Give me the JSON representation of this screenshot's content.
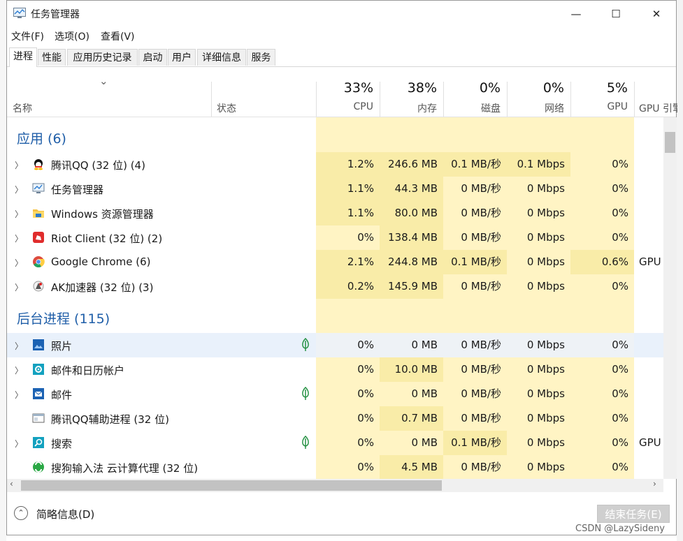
{
  "window": {
    "title": "任务管理器",
    "minimize": "—",
    "maximize": "☐",
    "close": "✕"
  },
  "menu": [
    "文件(F)",
    "选项(O)",
    "查看(V)"
  ],
  "tabs": [
    "进程",
    "性能",
    "应用历史记录",
    "启动",
    "用户",
    "详细信息",
    "服务"
  ],
  "header": {
    "sort_arrow": "⌄",
    "name": "名称",
    "status": "状态",
    "cpu": {
      "pct": "33%",
      "label": "CPU"
    },
    "mem": {
      "pct": "38%",
      "label": "内存"
    },
    "disk": {
      "pct": "0%",
      "label": "磁盘"
    },
    "net": {
      "pct": "0%",
      "label": "网络"
    },
    "gpu": {
      "pct": "5%",
      "label": "GPU"
    },
    "gpu_engine": "GPU 引擎"
  },
  "groups": {
    "apps": "应用 (6)",
    "background": "后台进程 (115)"
  },
  "apps": [
    {
      "name": "腾讯QQ (32 位) (4)",
      "icon": "qq-icon",
      "cpu": "1.2%",
      "mem": "246.6 MB",
      "disk": "0.1 MB/秒",
      "net": "0.1 Mbps",
      "gpu": "0%",
      "engine": ""
    },
    {
      "name": "任务管理器",
      "icon": "task-manager-icon",
      "cpu": "1.1%",
      "mem": "44.3 MB",
      "disk": "0 MB/秒",
      "net": "0 Mbps",
      "gpu": "0%",
      "engine": ""
    },
    {
      "name": "Windows 资源管理器",
      "icon": "folder-icon",
      "cpu": "1.1%",
      "mem": "80.0 MB",
      "disk": "0 MB/秒",
      "net": "0 Mbps",
      "gpu": "0%",
      "engine": ""
    },
    {
      "name": "Riot Client (32 位) (2)",
      "icon": "riot-icon",
      "cpu": "0%",
      "mem": "138.4 MB",
      "disk": "0 MB/秒",
      "net": "0 Mbps",
      "gpu": "0%",
      "engine": ""
    },
    {
      "name": "Google Chrome (6)",
      "icon": "chrome-icon",
      "cpu": "2.1%",
      "mem": "244.8 MB",
      "disk": "0.1 MB/秒",
      "net": "0 Mbps",
      "gpu": "0.6%",
      "engine": "GPU"
    },
    {
      "name": "AK加速器 (32 位) (3)",
      "icon": "ak-accelerator-icon",
      "cpu": "0.2%",
      "mem": "145.9 MB",
      "disk": "0 MB/秒",
      "net": "0 Mbps",
      "gpu": "0%",
      "engine": ""
    }
  ],
  "background": [
    {
      "name": "照片",
      "icon": "photos-icon",
      "cpu": "0%",
      "mem": "0 MB",
      "disk": "0 MB/秒",
      "net": "0 Mbps",
      "gpu": "0%",
      "engine": ""
    },
    {
      "name": "邮件和日历帐户",
      "icon": "gear-icon",
      "cpu": "0%",
      "mem": "10.0 MB",
      "disk": "0 MB/秒",
      "net": "0 Mbps",
      "gpu": "0%",
      "engine": ""
    },
    {
      "name": "邮件",
      "icon": "mail-icon",
      "cpu": "0%",
      "mem": "0 MB",
      "disk": "0 MB/秒",
      "net": "0 Mbps",
      "gpu": "0%",
      "engine": ""
    },
    {
      "name": "腾讯QQ辅助进程 (32 位)",
      "icon": "window-icon",
      "cpu": "0%",
      "mem": "0.7 MB",
      "disk": "0 MB/秒",
      "net": "0 Mbps",
      "gpu": "0%",
      "engine": ""
    },
    {
      "name": "搜索",
      "icon": "search-icon",
      "cpu": "0%",
      "mem": "0 MB",
      "disk": "0.1 MB/秒",
      "net": "0 Mbps",
      "gpu": "0%",
      "engine": "GPU"
    },
    {
      "name": "搜狗输入法 云计算代理 (32 位)",
      "icon": "sogou-icon",
      "cpu": "0%",
      "mem": "4.5 MB",
      "disk": "0 MB/秒",
      "net": "0 Mbps",
      "gpu": "0%",
      "engine": ""
    }
  ],
  "footer": {
    "fewer_details": "简略信息(D)",
    "end_task": "结束任务(E)"
  },
  "watermark": "CSDN @LazySideny",
  "colors": {
    "heat_light": "#fff4c4",
    "heat_mid": "#f9eca8",
    "group": "#1f5ea8",
    "selected_row": "#e9f1fb"
  }
}
